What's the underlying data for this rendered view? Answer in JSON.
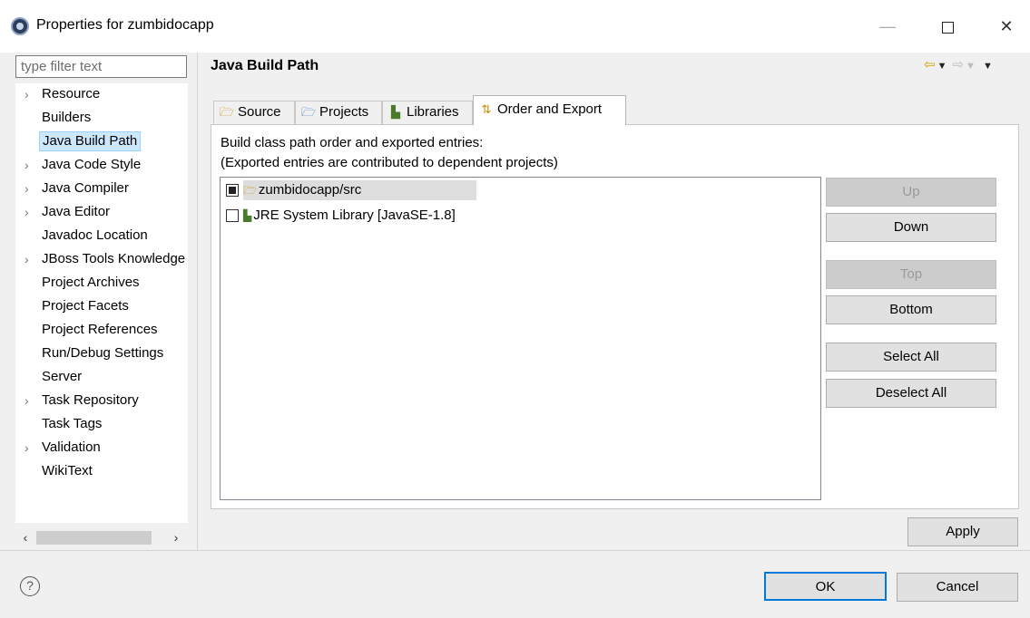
{
  "window": {
    "title": "Properties for zumbidocapp",
    "minimize_glyph": "—",
    "close_glyph": "✕"
  },
  "sidebar": {
    "filter_placeholder": "type filter text",
    "items": [
      {
        "label": "Resource",
        "expandable": true
      },
      {
        "label": "Builders",
        "expandable": false
      },
      {
        "label": "Java Build Path",
        "expandable": false,
        "selected": true
      },
      {
        "label": "Java Code Style",
        "expandable": true
      },
      {
        "label": "Java Compiler",
        "expandable": true
      },
      {
        "label": "Java Editor",
        "expandable": true
      },
      {
        "label": "Javadoc Location",
        "expandable": false
      },
      {
        "label": "JBoss Tools Knowledge",
        "expandable": true
      },
      {
        "label": "Project Archives",
        "expandable": false
      },
      {
        "label": "Project Facets",
        "expandable": false
      },
      {
        "label": "Project References",
        "expandable": false
      },
      {
        "label": "Run/Debug Settings",
        "expandable": false
      },
      {
        "label": "Server",
        "expandable": false
      },
      {
        "label": "Task Repository",
        "expandable": true
      },
      {
        "label": "Task Tags",
        "expandable": false
      },
      {
        "label": "Validation",
        "expandable": true
      },
      {
        "label": "WikiText",
        "expandable": false
      }
    ]
  },
  "main": {
    "title": "Java Build Path",
    "tabs": [
      {
        "label": "Source",
        "icon": "source-folder-icon"
      },
      {
        "label": "Projects",
        "icon": "projects-icon"
      },
      {
        "label": "Libraries",
        "icon": "libraries-icon"
      },
      {
        "label": "Order and Export",
        "icon": "order-export-icon",
        "active": true
      }
    ],
    "description_line1": "Build class path order and exported entries:",
    "description_line2": "(Exported entries are contributed to dependent projects)",
    "entries": [
      {
        "label": "zumbidocapp/src",
        "checked": true,
        "selected": true,
        "icon": "source-folder-icon"
      },
      {
        "label": "JRE System Library [JavaSE-1.8]",
        "checked": false,
        "selected": false,
        "icon": "library-icon"
      }
    ],
    "buttons": {
      "up": "Up",
      "down": "Down",
      "top": "Top",
      "bottom": "Bottom",
      "select_all": "Select All",
      "deselect_all": "Deselect All"
    },
    "apply": "Apply"
  },
  "footer": {
    "help": "?",
    "ok": "OK",
    "cancel": "Cancel"
  },
  "colors": {
    "accent": "#0078d7",
    "selection": "#cce8ff",
    "nav_arrow": "#d4a000"
  }
}
